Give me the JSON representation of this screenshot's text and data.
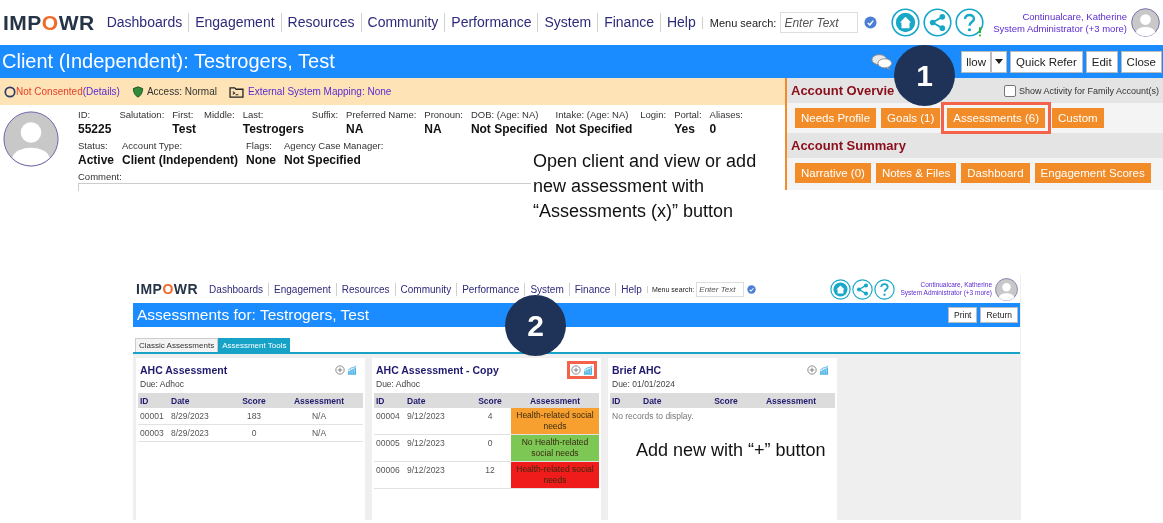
{
  "top_screen": {
    "nav": {
      "logo": "IMPOWR",
      "items": [
        "Dashboards",
        "Engagement",
        "Resources",
        "Community",
        "Performance",
        "System",
        "Finance",
        "Help"
      ],
      "search_label": "Menu search:",
      "search": {
        "placeholder": "Enter Text"
      },
      "user_name": "Continualcare, Katherine",
      "user_role": "System Administrator (+3 more)"
    },
    "title": "Client (Independent): Testrogers, Test",
    "actions": [
      "llow",
      "Quick Refer",
      "Edit",
      "Close"
    ],
    "status": {
      "consent": "Not Consented",
      "details": "(Details)",
      "access": "Access: Normal",
      "mapping": "External System Mapping: None"
    },
    "fields": [
      [
        {
          "label": "ID:",
          "value": "55225"
        },
        {
          "label": "Salutation:"
        },
        {
          "label": "First:",
          "value": "Test"
        },
        {
          "label": "Middle:"
        },
        {
          "label": "Last:",
          "value": "Testrogers"
        },
        {
          "label": "Suffix:"
        },
        {
          "label": "Preferred Name:",
          "value": "NA"
        },
        {
          "label": "Pronoun:",
          "value": "NA"
        },
        {
          "label": "DOB: (Age: NA)",
          "value": "Not Specified"
        },
        {
          "label": "Intake: (Age: NA)",
          "value": "Not Specified"
        },
        {
          "label": "Login:"
        },
        {
          "label": "Portal:",
          "value": "Yes"
        },
        {
          "label": "Aliases:",
          "value": "0"
        }
      ],
      [
        {
          "label": "Status:",
          "value": "Active"
        },
        {
          "label": "Account Type:",
          "value": "Client (Independent)"
        },
        {
          "label": "Flags:",
          "value": "None"
        },
        {
          "label": "Agency Case Manager:",
          "value": "Not Specified"
        }
      ]
    ],
    "comment_label": "Comment:",
    "overview": {
      "title": "Account Overvie",
      "family_checkbox": {
        "label": "Show Activity for Family Account(s)",
        "checked": false
      },
      "buttons": [
        {
          "label": "Needs Profile",
          "highlighted": false
        },
        {
          "label": "Goals (1)",
          "highlighted": false
        },
        {
          "label": "Assessments (6)",
          "highlighted": true
        },
        {
          "label": "Custom",
          "highlighted": false
        }
      ],
      "summary_title": "Account Summary",
      "summary_buttons": [
        "Narrative (0)",
        "Notes & Files",
        "Dashboard",
        "Engagement Scores"
      ]
    }
  },
  "caption_1": "Open client and view or add new assessment with “Assessments (x)” button",
  "bottom_screen": {
    "nav": {
      "logo": "IMPOWR",
      "items": [
        "Dashboards",
        "Engagement",
        "Resources",
        "Community",
        "Performance",
        "System",
        "Finance",
        "Help"
      ],
      "search_label": "Menu search:",
      "search": {
        "placeholder": "Enter Text"
      },
      "user_name": "Continualcare, Katherine",
      "user_role": "System Administrator (+3 more)"
    },
    "title": "Assessments for: Testrogers, Test",
    "actions": [
      "Print",
      "Return"
    ],
    "tabs": [
      {
        "label": "Classic Assessments",
        "selected": false
      },
      {
        "label": "Assessment Tools",
        "selected": true
      }
    ],
    "cards": [
      {
        "title": "AHC Assessment",
        "due": "Due: Adhoc",
        "highlighted": false,
        "columns": [
          "ID",
          "Date",
          "Score",
          "Assessment"
        ],
        "rows": [
          {
            "cells": [
              "00001",
              "8/29/2023",
              "183",
              "N/A"
            ]
          },
          {
            "cells": [
              "00003",
              "8/29/2023",
              "0",
              "N/A"
            ]
          }
        ]
      },
      {
        "title": "AHC Assessment - Copy",
        "due": "Due: Adhoc",
        "highlighted": true,
        "columns": [
          "ID",
          "Date",
          "Score",
          "Assessment"
        ],
        "rows": [
          {
            "cells": [
              "00004",
              "9/12/2023",
              "4",
              "Health-related social needs"
            ],
            "color": "#f7a030"
          },
          {
            "cells": [
              "00005",
              "9/12/2023",
              "0",
              "No Health-related social needs"
            ],
            "color": "#7dc855"
          },
          {
            "cells": [
              "00006",
              "9/12/2023",
              "12",
              "Health-related social needs"
            ],
            "color": "#f01c1c"
          }
        ]
      },
      {
        "title": "Brief AHC",
        "due": "Due: 01/01/2024",
        "highlighted": false,
        "columns": [
          "ID",
          "Date",
          "Score",
          "Assessment"
        ],
        "empty_text": "No records to display."
      }
    ]
  },
  "caption_2": "Add new with “+” button",
  "callouts": [
    "1",
    "2"
  ]
}
